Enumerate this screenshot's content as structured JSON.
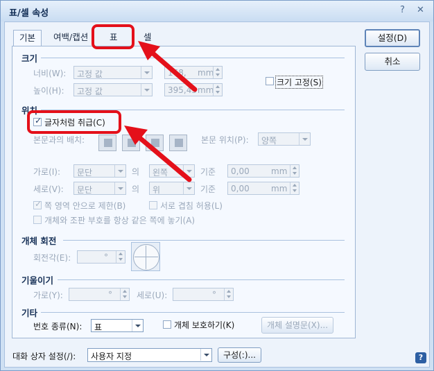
{
  "window": {
    "title": "표/셀 속성",
    "help_glyph": "?",
    "close_glyph": "✕"
  },
  "tabs": [
    {
      "label": "기본"
    },
    {
      "label": "여백/캡션"
    },
    {
      "label": "표"
    },
    {
      "label": "셀"
    }
  ],
  "size": {
    "section": "크기",
    "width_label": "너비(W):",
    "width_mode": "고정 값",
    "width_value": "168,",
    "width_unit": "mm",
    "height_label": "높이(H):",
    "height_mode": "고정 값",
    "height_value": "395,43",
    "height_unit": "mm",
    "fix_size_label": "크기 고정(S)"
  },
  "position": {
    "section": "위치",
    "treat_as_char_label": "글자처럼 취급(C)",
    "wrap_label": "본문과의 배치:",
    "body_pos_label": "본문 위치(P):",
    "body_pos_value": "양쪽",
    "horiz_label": "가로(I):",
    "horiz_ref": "문단",
    "horiz_of": "의",
    "horiz_align": "왼쪽",
    "horiz_basis": "기준",
    "horiz_value": "0,00",
    "horiz_unit": "mm",
    "vert_label": "세로(V):",
    "vert_ref": "문단",
    "vert_of": "의",
    "vert_align": "위",
    "vert_basis": "기준",
    "vert_value": "0,00",
    "vert_unit": "mm",
    "restrict_label": "쪽 영역 안으로 제한(B)",
    "overlap_label": "서로 겹침 허용(L)",
    "same_page_label": "개체와 조판 부호를 항상 같은 쪽에 놓기(A)"
  },
  "rotation": {
    "section": "개체 회전",
    "angle_label": "회전각(E):",
    "angle_unit": "°"
  },
  "skew": {
    "section": "기울이기",
    "x_label": "가로(Y):",
    "x_unit": "°",
    "y_label": "세로(U):",
    "y_unit": "°"
  },
  "misc": {
    "section": "기타",
    "number_type_label": "번호 종류(N):",
    "number_type_value": "표",
    "protect_label": "개체 보호하기(K)",
    "desc_button": "개체 설명문(X)..."
  },
  "buttons": {
    "ok": "설정(D)",
    "cancel": "취소"
  },
  "footer": {
    "dialog_setting_label": "대화 상자 설정(/):",
    "dialog_setting_value": "사용자 지정",
    "config_button": "구성(:)...",
    "help_glyph": "?"
  },
  "colors": {
    "highlight": "#e4101a",
    "accent": "#2d5fa3"
  }
}
